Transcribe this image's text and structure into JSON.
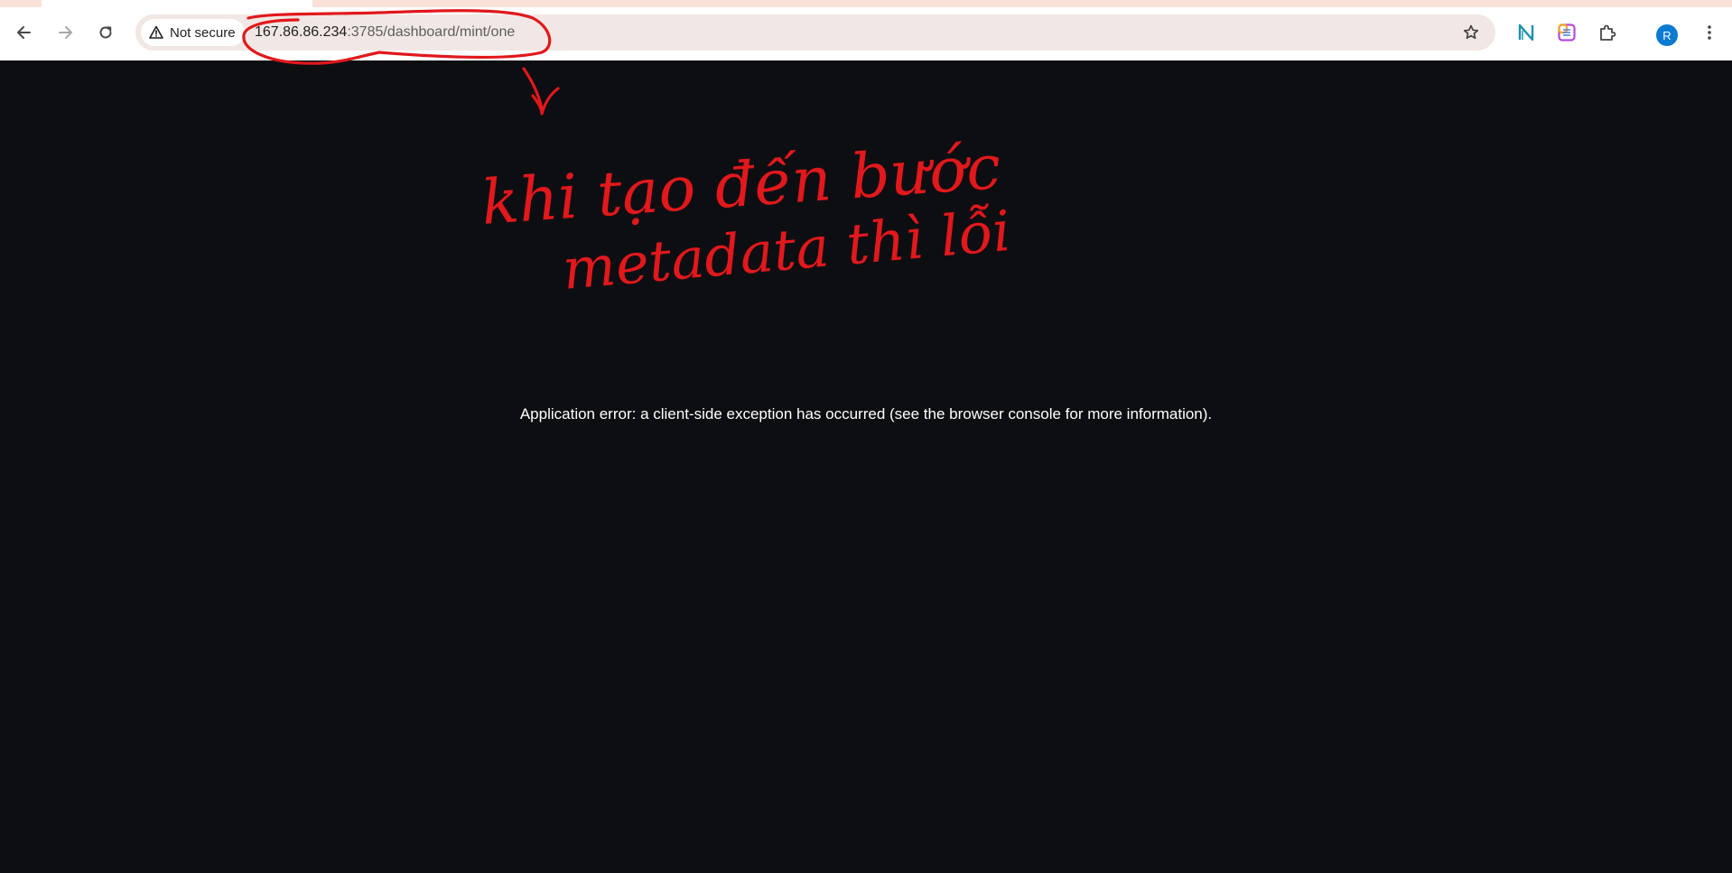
{
  "browser": {
    "security_label": "Not secure",
    "url_host": "167.86.86.234",
    "url_rest": ":3785/dashboard/mint/one",
    "profile_initial": "R",
    "icons": {
      "back": "arrow-left-icon",
      "forward": "arrow-right-icon",
      "reload": "reload-icon",
      "warning": "warning-triangle-icon",
      "bookmark": "star-icon",
      "extension_1": "n-logo-icon",
      "extension_2": "colorful-square-icon",
      "extensions": "puzzle-icon",
      "menu": "more-vert-icon"
    },
    "colors": {
      "omnibox_bg": "#f1e7e4",
      "avatar": "#0b7ad1",
      "page_bg": "#0d0e12"
    }
  },
  "page": {
    "error_message": "Application error: a client-side exception has occurred (see the browser console for more information)."
  },
  "annotation": {
    "color": "#e1181c",
    "line_1": "khi tạo đến bước",
    "line_2": "metadata thì lỗi"
  }
}
